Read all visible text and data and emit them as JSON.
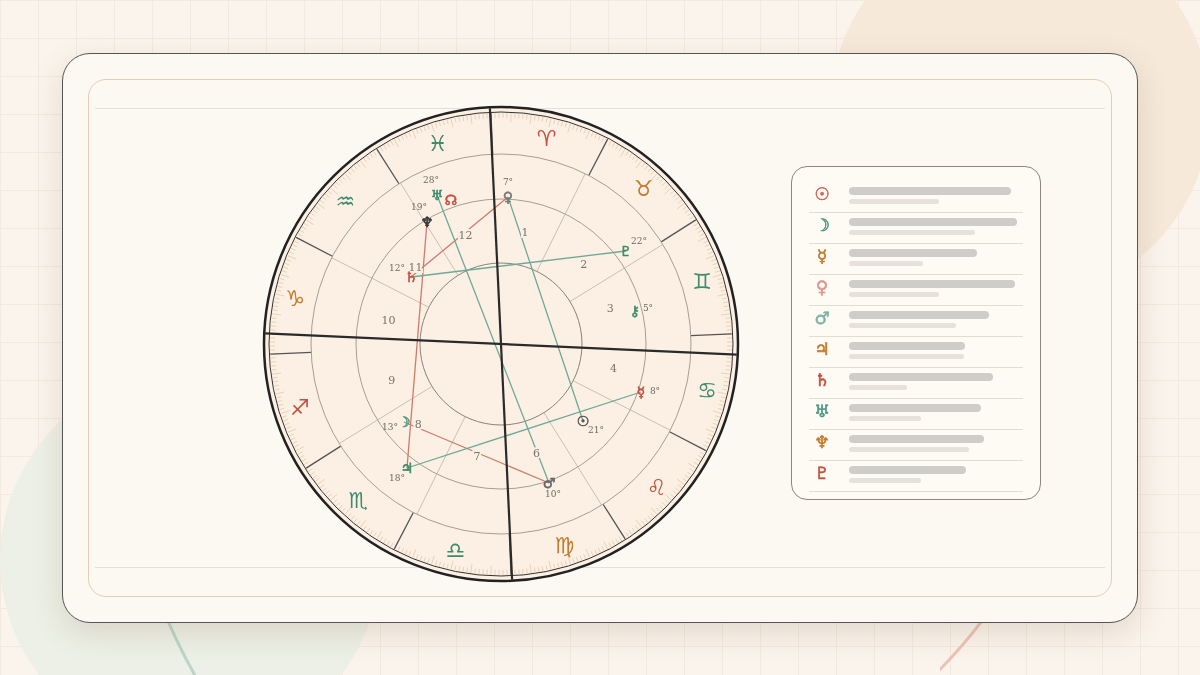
{
  "chart": {
    "signs": [
      {
        "symbol": "♈",
        "color": "#c4503f"
      },
      {
        "symbol": "♉",
        "color": "#c47a2c"
      },
      {
        "symbol": "♊",
        "color": "#3f8a6e"
      },
      {
        "symbol": "♋",
        "color": "#3f8a6e"
      },
      {
        "symbol": "♌",
        "color": "#c4503f"
      },
      {
        "symbol": "♍",
        "color": "#c47a2c"
      },
      {
        "symbol": "♎",
        "color": "#3f8a6e"
      },
      {
        "symbol": "♏",
        "color": "#3f8a6e"
      },
      {
        "symbol": "♐",
        "color": "#c4503f"
      },
      {
        "symbol": "♑",
        "color": "#c47a2c"
      },
      {
        "symbol": "♒",
        "color": "#3f8a6e"
      },
      {
        "symbol": "♓",
        "color": "#3f8a6e"
      }
    ],
    "houses": [
      "1",
      "2",
      "3",
      "4",
      "6",
      "7",
      "8",
      "9",
      "10",
      "11",
      "12"
    ],
    "planets": [
      {
        "symbol": "♅",
        "degree": "28°",
        "color": "#3f8a6e"
      },
      {
        "symbol": "☊",
        "color": "#c4503f"
      },
      {
        "symbol": "♀",
        "degree": "7°",
        "color": "#777777"
      },
      {
        "symbol": "♆",
        "degree": "19°",
        "color": "#333333"
      },
      {
        "symbol": "♇",
        "degree": "22°",
        "color": "#3f8a6e"
      },
      {
        "symbol": "♄",
        "degree": "12°",
        "color": "#c4503f"
      },
      {
        "symbol": "⚷",
        "degree": "5°",
        "color": "#3f8a6e"
      },
      {
        "symbol": "☿",
        "degree": "8°",
        "color": "#c4503f"
      },
      {
        "symbol": "☽",
        "degree": "13°",
        "color": "#4c9a85"
      },
      {
        "symbol": "☉",
        "degree": "21°",
        "color": "#555555"
      },
      {
        "symbol": "♃",
        "degree": "18°",
        "color": "#3f8a6e"
      },
      {
        "symbol": "♂",
        "degree": "10°",
        "color": "#666666"
      }
    ]
  },
  "legend": [
    {
      "symbol": "☉",
      "color": "#d0675a"
    },
    {
      "symbol": "☽",
      "color": "#4c9a85"
    },
    {
      "symbol": "☿",
      "color": "#c47a2c"
    },
    {
      "symbol": "♀",
      "color": "#e0968c"
    },
    {
      "symbol": "♂",
      "color": "#7fb3a5"
    },
    {
      "symbol": "♃",
      "color": "#c47a2c"
    },
    {
      "symbol": "♄",
      "color": "#c4503f"
    },
    {
      "symbol": "♅",
      "color": "#4c9a85"
    },
    {
      "symbol": "♆",
      "color": "#c47a2c"
    },
    {
      "symbol": "♇",
      "color": "#c4503f"
    }
  ]
}
